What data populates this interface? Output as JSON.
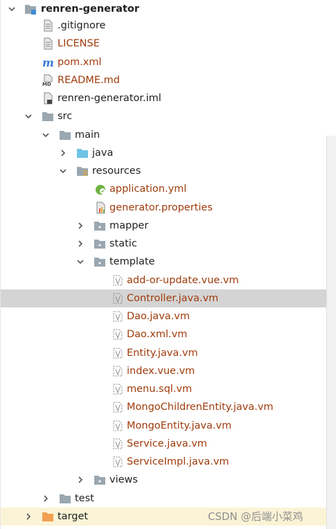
{
  "tree": {
    "root": "renren-generator",
    "files_root": [
      ".gitignore",
      "LICENSE",
      "pom.xml",
      "README.md",
      "renren-generator.iml"
    ],
    "src": "src",
    "main": "main",
    "java": "java",
    "resources": "resources",
    "application_yml": "application.yml",
    "generator_properties": "generator.properties",
    "mapper": "mapper",
    "static": "static",
    "template": "template",
    "templates": [
      "add-or-update.vue.vm",
      "Controller.java.vm",
      "Dao.java.vm",
      "Dao.xml.vm",
      "Entity.java.vm",
      "index.vue.vm",
      "menu.sql.vm",
      "MongoChildrenEntity.java.vm",
      "MongoEntity.java.vm",
      "Service.java.vm",
      "ServiceImpl.java.vm"
    ],
    "views": "views",
    "test": "test",
    "target": "target"
  },
  "icons": {
    "chevron_open": "chevron-down-icon",
    "chevron_closed": "chevron-right-icon",
    "module_folder": "module-folder-icon",
    "folder": "folder-icon",
    "source_folder": "source-folder-icon",
    "resources_folder": "resources-folder-icon",
    "excluded_folder": "excluded-folder-icon",
    "file": "text-file-icon",
    "maven": "maven-icon",
    "markdown": "markdown-icon",
    "iml": "iml-file-icon",
    "spring": "spring-config-icon",
    "properties": "properties-file-icon",
    "velocity": "velocity-template-icon"
  },
  "watermark": "CSDN @后端小菜鸡",
  "colors": {
    "vcs_unversioned": "#9f3b0a",
    "selection": "#d4d4d4",
    "folder": "#9aa7b0",
    "source_folder": "#6fc3e6",
    "excluded_folder": "#f0a050"
  }
}
